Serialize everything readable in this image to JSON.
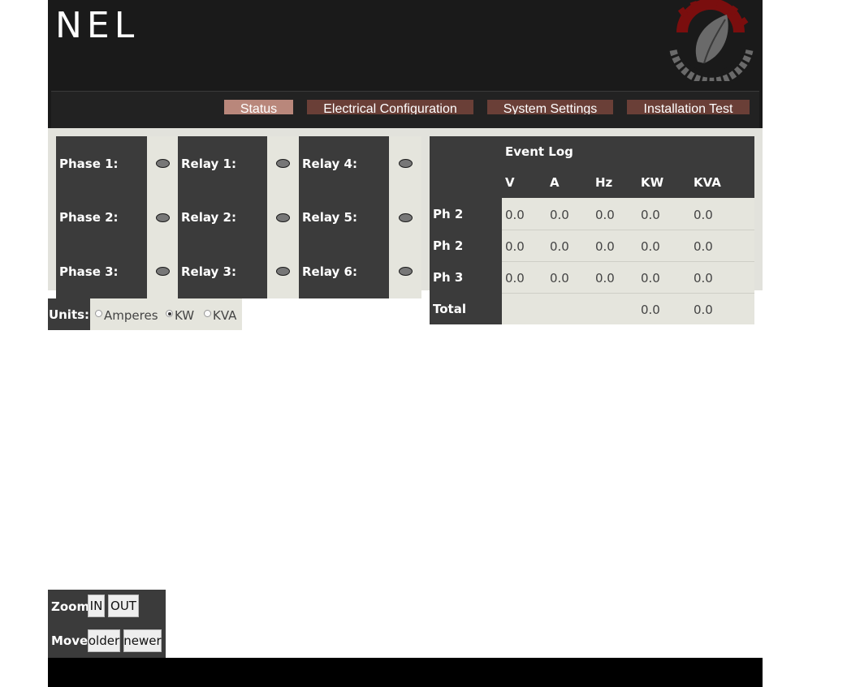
{
  "brand": {
    "title": "NEL"
  },
  "nav": {
    "tabs": [
      {
        "label": "Status",
        "active": true
      },
      {
        "label": "Electrical Configuration",
        "active": false
      },
      {
        "label": "System Settings",
        "active": false
      },
      {
        "label": "Installation Test",
        "active": false
      }
    ]
  },
  "indicators": {
    "phases": [
      "Phase 1:",
      "Phase 2:",
      "Phase 3:"
    ],
    "relays_a": [
      "Relay 1:",
      "Relay 2:",
      "Relay 3:"
    ],
    "relays_b": [
      "Relay 4:",
      "Relay 5:",
      "Relay 6:"
    ],
    "led_color": "#777777"
  },
  "event_log": {
    "title": "Event Log",
    "columns": [
      "V",
      "A",
      "Hz",
      "KW",
      "KVA"
    ],
    "rows": [
      {
        "label": "Ph 2",
        "values": [
          "0.0",
          "0.0",
          "0.0",
          "0.0",
          "0.0"
        ]
      },
      {
        "label": "Ph 2",
        "values": [
          "0.0",
          "0.0",
          "0.0",
          "0.0",
          "0.0"
        ]
      },
      {
        "label": "Ph 3",
        "values": [
          "0.0",
          "0.0",
          "0.0",
          "0.0",
          "0.0"
        ]
      },
      {
        "label": "Total",
        "values": [
          "",
          "",
          "",
          "0.0",
          "0.0"
        ]
      }
    ]
  },
  "units": {
    "label": "Units:",
    "options": [
      {
        "label": "Amperes",
        "selected": false
      },
      {
        "label": "KW",
        "selected": true
      },
      {
        "label": "KVA",
        "selected": false
      }
    ]
  },
  "controls": {
    "zoom_label": "Zoom",
    "zoom_in": "IN",
    "zoom_out": "OUT",
    "move_label": "Move",
    "older": "older",
    "newer": "newer"
  },
  "colors": {
    "header_bg": "#1a1a1a",
    "tab_active": "#b9877b",
    "tab_inactive": "#6a3f37",
    "panel_dark": "#3b3b3b",
    "panel_light": "#e5e5dd"
  }
}
